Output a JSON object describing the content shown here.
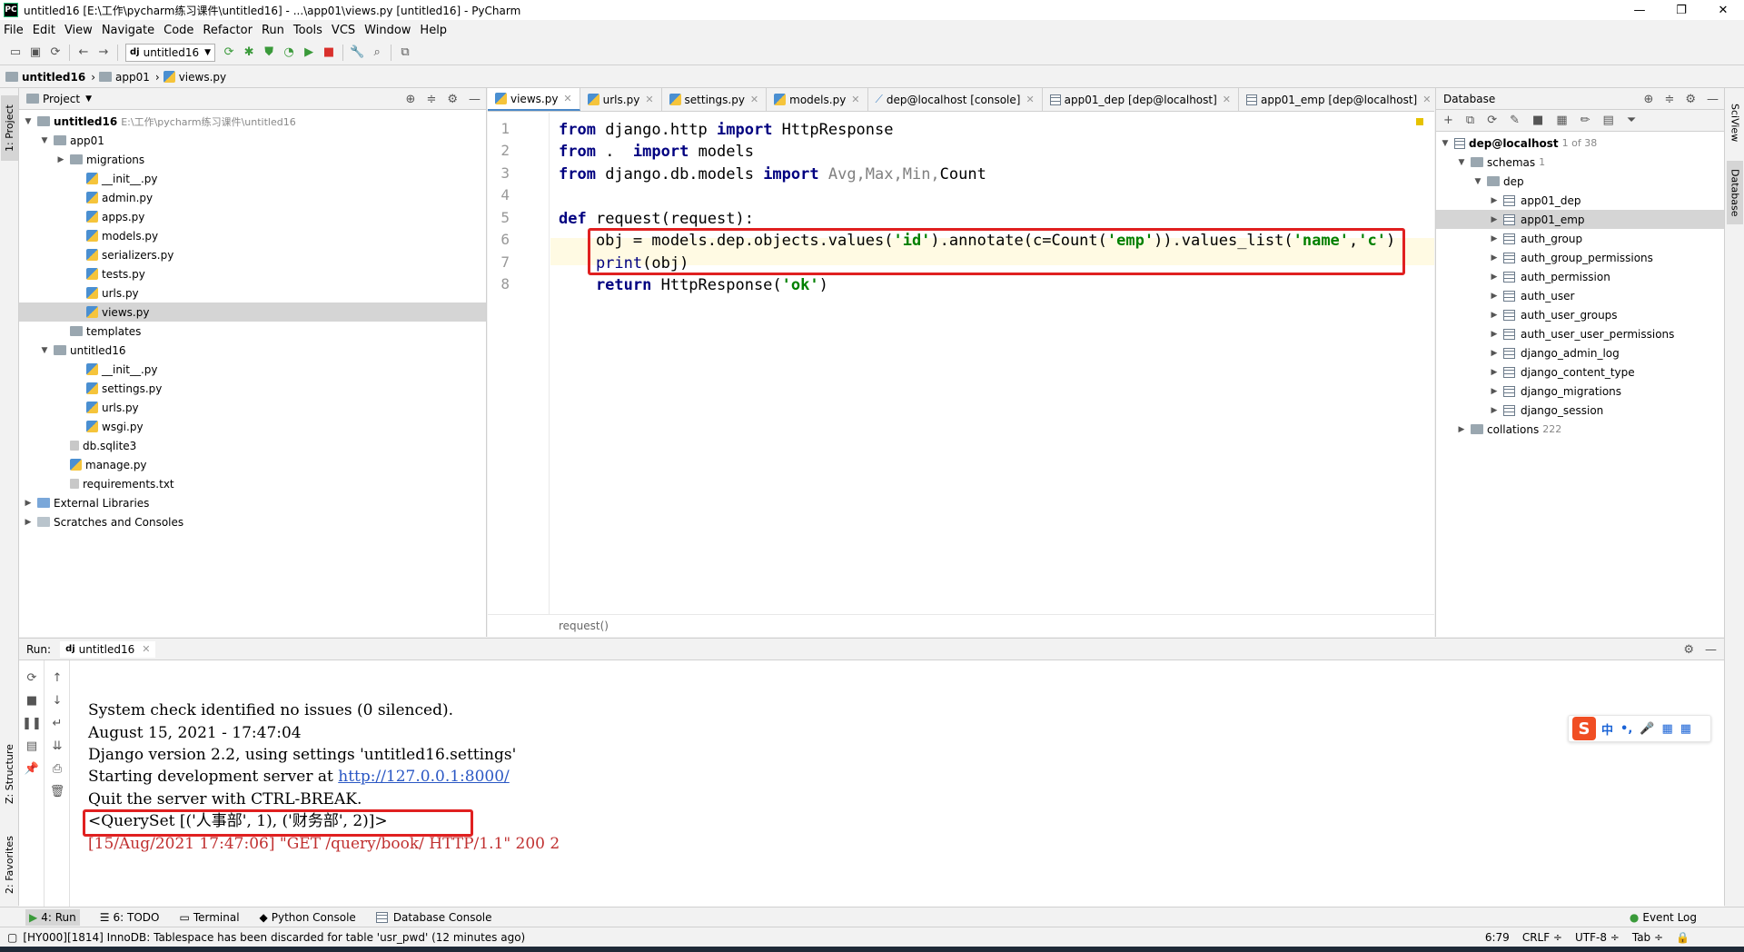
{
  "window": {
    "title": "untitled16 [E:\\工作\\pycharm练习课件\\untitled16] - ...\\app01\\views.py [untitled16] - PyCharm",
    "app_icon": "PC",
    "min": "—",
    "max": "❐",
    "close": "✕"
  },
  "menu": [
    "File",
    "Edit",
    "View",
    "Navigate",
    "Code",
    "Refactor",
    "Run",
    "Tools",
    "VCS",
    "Window",
    "Help"
  ],
  "toolbar": {
    "run_config": "untitled16"
  },
  "breadcrumb": [
    "untitled16",
    "app01",
    "views.py"
  ],
  "left_strip": {
    "project": "1: Project",
    "structure": "Z: Structure",
    "favorites": "2: Favorites"
  },
  "project_panel": {
    "title": "Project",
    "tree": [
      {
        "label": "untitled16",
        "hint": "E:\\工作\\pycharm练习课件\\untitled16",
        "indent": 0,
        "arrow": "▼",
        "type": "folder",
        "bold": true
      },
      {
        "label": "app01",
        "indent": 1,
        "arrow": "▼",
        "type": "folder"
      },
      {
        "label": "migrations",
        "indent": 2,
        "arrow": "▶",
        "type": "folder"
      },
      {
        "label": "__init__.py",
        "indent": 3,
        "arrow": "",
        "type": "py"
      },
      {
        "label": "admin.py",
        "indent": 3,
        "arrow": "",
        "type": "py"
      },
      {
        "label": "apps.py",
        "indent": 3,
        "arrow": "",
        "type": "py"
      },
      {
        "label": "models.py",
        "indent": 3,
        "arrow": "",
        "type": "py"
      },
      {
        "label": "serializers.py",
        "indent": 3,
        "arrow": "",
        "type": "py"
      },
      {
        "label": "tests.py",
        "indent": 3,
        "arrow": "",
        "type": "py"
      },
      {
        "label": "urls.py",
        "indent": 3,
        "arrow": "",
        "type": "py"
      },
      {
        "label": "views.py",
        "indent": 3,
        "arrow": "",
        "type": "py",
        "selected": true
      },
      {
        "label": "templates",
        "indent": 2,
        "arrow": "",
        "type": "folder"
      },
      {
        "label": "untitled16",
        "indent": 1,
        "arrow": "▼",
        "type": "folder"
      },
      {
        "label": "__init__.py",
        "indent": 3,
        "arrow": "",
        "type": "py"
      },
      {
        "label": "settings.py",
        "indent": 3,
        "arrow": "",
        "type": "py"
      },
      {
        "label": "urls.py",
        "indent": 3,
        "arrow": "",
        "type": "py"
      },
      {
        "label": "wsgi.py",
        "indent": 3,
        "arrow": "",
        "type": "py"
      },
      {
        "label": "db.sqlite3",
        "indent": 2,
        "arrow": "",
        "type": "file"
      },
      {
        "label": "manage.py",
        "indent": 2,
        "arrow": "",
        "type": "py"
      },
      {
        "label": "requirements.txt",
        "indent": 2,
        "arrow": "",
        "type": "file"
      },
      {
        "label": "External Libraries",
        "indent": 0,
        "arrow": "▶",
        "type": "lib"
      },
      {
        "label": "Scratches and Consoles",
        "indent": 0,
        "arrow": "▶",
        "type": "scratch"
      }
    ]
  },
  "editor": {
    "tabs": [
      {
        "label": "views.py",
        "icon": "py",
        "active": true
      },
      {
        "label": "urls.py",
        "icon": "py"
      },
      {
        "label": "settings.py",
        "icon": "py"
      },
      {
        "label": "models.py",
        "icon": "py"
      },
      {
        "label": "dep@localhost [console]",
        "icon": "console"
      },
      {
        "label": "app01_dep [dep@localhost]",
        "icon": "db"
      },
      {
        "label": "app01_emp [dep@localhost]",
        "icon": "db"
      }
    ],
    "line_numbers": [
      "1",
      "2",
      "3",
      "4",
      "5",
      "6",
      "7",
      "8"
    ],
    "lines": {
      "l1": {
        "k1": "from",
        "t1": " django.http ",
        "k2": "import",
        "t2": " HttpResponse"
      },
      "l2": {
        "k1": "from",
        "t1": " .  ",
        "k2": "import",
        "t2": " models"
      },
      "l3": {
        "k1": "from",
        "t1": " django.db.models ",
        "k2": "import",
        "g1": " Avg,Max,Min,",
        "t2": "Count"
      },
      "l5": {
        "k1": "def",
        "t1": " request(request):"
      },
      "l6": {
        "t1": "    obj = models.dep.objects.values(",
        "s1": "'id'",
        "t2": ").annotate(c=Count(",
        "s2": "'emp'",
        "t3": ")).values_list(",
        "s3": "'name'",
        "t4": ",",
        "s4": "'c'",
        "t5": ")"
      },
      "l7": {
        "f1": "    print",
        "t1": "(obj)"
      },
      "l8": {
        "k1": "    return",
        "t1": " HttpResponse(",
        "s1": "'ok'",
        "t2": ")"
      }
    },
    "status_breadcrumb": "request()"
  },
  "database_panel": {
    "title": "Database",
    "connection": "dep@localhost",
    "connection_hint": "1 of 38",
    "schemas_label": "schemas",
    "schemas_count": "1",
    "schema": "dep",
    "tables": [
      "app01_dep",
      "app01_emp",
      "auth_group",
      "auth_group_permissions",
      "auth_permission",
      "auth_user",
      "auth_user_groups",
      "auth_user_user_permissions",
      "django_admin_log",
      "django_content_type",
      "django_migrations",
      "django_session"
    ],
    "selected_table": "app01_emp",
    "collations_label": "collations",
    "collations_count": "222"
  },
  "right_strip": {
    "sciview": "SciView",
    "database": "Database"
  },
  "run_panel": {
    "label": "Run:",
    "tab": "untitled16",
    "console": {
      "line1": "System check identified no issues (0 silenced).",
      "line2": "August 15, 2021 - 17:47:04",
      "line3": "Django version 2.2, using settings 'untitled16.settings'",
      "line4_prefix": "Starting development server at ",
      "line4_link": "http://127.0.0.1:8000/",
      "line5": "Quit the server with CTRL-BREAK.",
      "line6": "<QuerySet [('人事部', 1), ('财务部', 2)]>",
      "line7": "[15/Aug/2021 17:47:06] \"GET /query/book/ HTTP/1.1\" 200 2"
    }
  },
  "bottom_tabs": [
    "4: Run",
    "6: TODO",
    "Terminal",
    "Python Console",
    "Database Console"
  ],
  "event_log": "Event Log",
  "status": {
    "message": "[HY000][1814] InnoDB: Tablespace has been discarded for table 'usr_pwd' (12 minutes ago)",
    "position": "6:79",
    "line_sep": "CRLF ÷",
    "encoding": "UTF-8 ÷",
    "indent": "Tab ÷"
  },
  "ime": {
    "logo": "S",
    "items": [
      "中",
      "•,",
      "🎤",
      "▦",
      "▦"
    ]
  },
  "colors": {
    "accent": "#4a88c7",
    "highlight_box": "#e02020",
    "keyword": "#000080",
    "string": "#008000"
  }
}
